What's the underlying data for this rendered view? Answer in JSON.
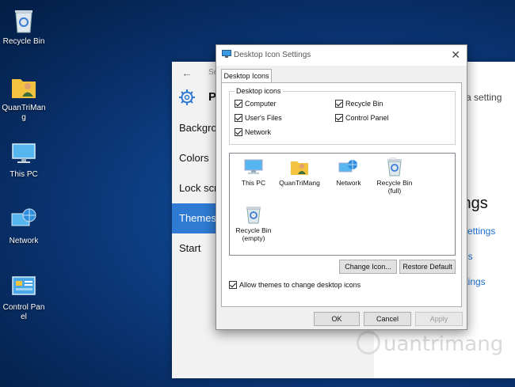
{
  "desktop": {
    "icons": [
      {
        "label": "Recycle Bin",
        "icon": "recycle-bin-icon"
      },
      {
        "label": "QuanTriMang",
        "icon": "user-folder-icon"
      },
      {
        "label": "This PC",
        "icon": "computer-icon"
      },
      {
        "label": "Network",
        "icon": "network-icon"
      },
      {
        "label": "Control Panel",
        "icon": "control-panel-icon"
      }
    ]
  },
  "settings": {
    "top_text": "Se",
    "header_letter": "P",
    "nav": [
      {
        "label": "Backgrou"
      },
      {
        "label": "Colors"
      },
      {
        "label": "Lock scre"
      },
      {
        "label": "Themes"
      },
      {
        "label": "Start"
      }
    ],
    "search_placeholder": "a setting",
    "heading": "ings",
    "links": [
      "settings",
      "gs",
      "ttings"
    ],
    "accent": "#2f7bd3"
  },
  "dialog": {
    "title": "Desktop Icon Settings",
    "tab": "Desktop Icons",
    "group_label": "Desktop icons",
    "checkboxes": [
      {
        "label": "Computer",
        "checked": true
      },
      {
        "label": "Recycle Bin",
        "checked": true
      },
      {
        "label": "User's Files",
        "checked": true
      },
      {
        "label": "Control Panel",
        "checked": true
      },
      {
        "label": "Network",
        "checked": true
      }
    ],
    "icon_list": [
      {
        "label": "This PC",
        "icon": "computer-icon"
      },
      {
        "label": "QuanTriMang",
        "icon": "user-folder-icon"
      },
      {
        "label": "Network",
        "icon": "network-icon"
      },
      {
        "label": "Recycle Bin (full)",
        "icon": "recycle-bin-full-icon"
      },
      {
        "label": "Recycle Bin (empty)",
        "icon": "recycle-bin-empty-icon"
      }
    ],
    "change_icon_label": "Change Icon...",
    "restore_default_label": "Restore Default",
    "allow_themes_label": "Allow themes to change desktop icons",
    "allow_themes_checked": true,
    "ok_label": "OK",
    "cancel_label": "Cancel",
    "apply_label": "Apply"
  },
  "watermark": "uantrimang"
}
